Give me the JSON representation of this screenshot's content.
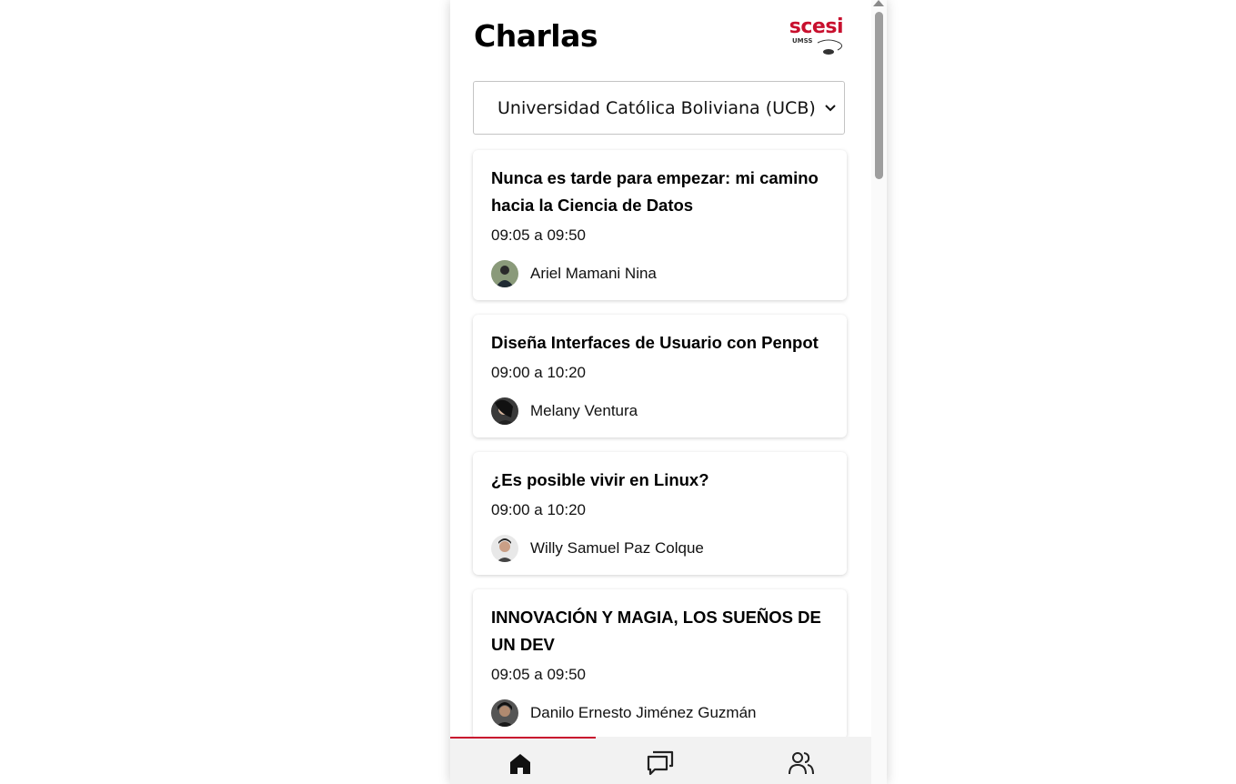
{
  "header": {
    "title": "Charlas"
  },
  "logo": {
    "word": "scesi",
    "sub": "UMSS"
  },
  "university_select": {
    "value": "Universidad Católica Boliviana (UCB)"
  },
  "talks": [
    {
      "title": "Nunca es tarde para empezar: mi camino hacia la Ciencia de Datos",
      "time": "09:05 a 09:50",
      "speaker": "Ariel Mamani Nina"
    },
    {
      "title": "Diseña Interfaces de Usuario con Penpot",
      "time": "09:00 a 10:20",
      "speaker": "Melany Ventura"
    },
    {
      "title": "¿Es posible vivir en Linux?",
      "time": "09:00 a 10:20",
      "speaker": "Willy Samuel Paz Colque"
    },
    {
      "title": "INNOVACIÓN Y MAGIA, LOS SUEÑOS DE UN DEV",
      "time": "09:05 a 09:50",
      "speaker": "Danilo Ernesto Jiménez Guzmán"
    }
  ],
  "nav": {
    "items": [
      "home-icon",
      "chat-icon",
      "people-icon"
    ],
    "accent": "#c8102e"
  }
}
